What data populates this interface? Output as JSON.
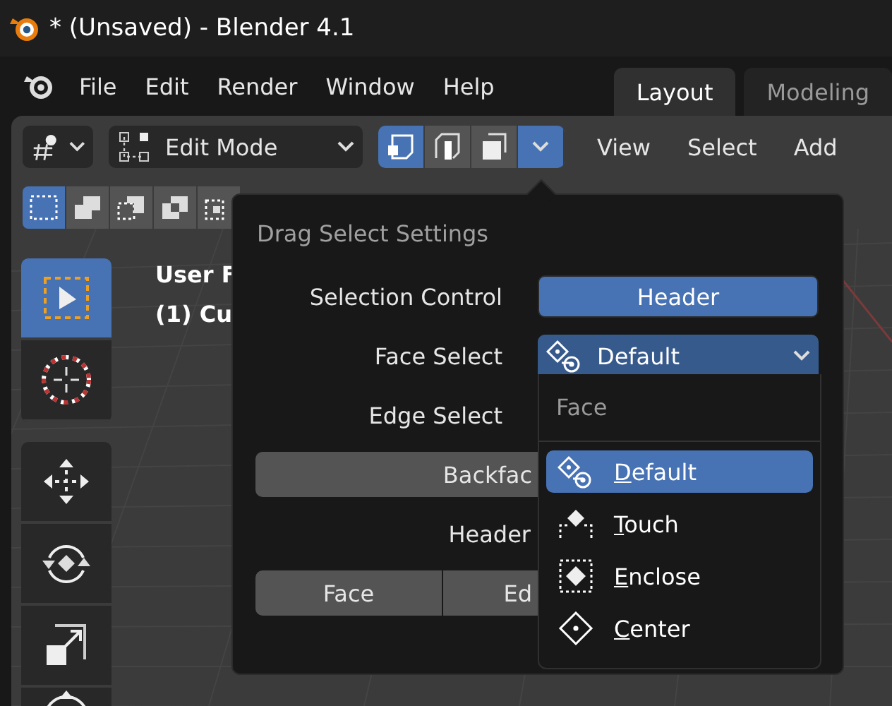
{
  "title_bar": {
    "title": "* (Unsaved) - Blender 4.1"
  },
  "menu_bar": {
    "items": [
      "File",
      "Edit",
      "Render",
      "Window",
      "Help"
    ]
  },
  "workspace_tabs": [
    {
      "label": "Layout",
      "selected": true
    },
    {
      "label": "Modeling",
      "selected": false
    }
  ],
  "header": {
    "mode": "Edit Mode",
    "select_modes": [
      {
        "kind": "vertex",
        "selected": true
      },
      {
        "kind": "edge",
        "selected": false
      },
      {
        "kind": "face",
        "selected": false
      }
    ],
    "menus": [
      "View",
      "Select",
      "Add"
    ]
  },
  "selection_modes": [
    {
      "kind": "set",
      "selected": true
    },
    {
      "kind": "extend",
      "selected": false
    },
    {
      "kind": "subtract",
      "selected": false
    },
    {
      "kind": "invert",
      "selected": false
    },
    {
      "kind": "intersect",
      "selected": false
    }
  ],
  "tool_groups": [
    [
      {
        "kind": "select_box",
        "selected": true
      },
      {
        "kind": "cursor",
        "selected": false
      }
    ],
    [
      {
        "kind": "move",
        "selected": false
      },
      {
        "kind": "rotate",
        "selected": false
      },
      {
        "kind": "scale",
        "selected": false
      },
      {
        "kind": "transform",
        "selected": false
      }
    ]
  ],
  "viewport_text": [
    "User F",
    "(1) Cu"
  ],
  "popover": {
    "title": "Drag Select Settings",
    "selection_control": {
      "label": "Selection Control",
      "value": "Header"
    },
    "face_select": {
      "label": "Face Select",
      "value": "Default",
      "expanded": true
    },
    "edge_select": {
      "label": "Edge Select"
    },
    "backface_button": "Backfac",
    "header_label": "Header",
    "toggle_buttons": [
      "Face",
      "Ed"
    ]
  },
  "dropdown": {
    "heading": "Face",
    "options": [
      {
        "kind": "default",
        "label": "Default",
        "selected": true
      },
      {
        "kind": "touch",
        "label": "Touch",
        "selected": false
      },
      {
        "kind": "enclose",
        "label": "Enclose",
        "selected": false
      },
      {
        "kind": "center",
        "label": "Center",
        "selected": false
      }
    ]
  }
}
